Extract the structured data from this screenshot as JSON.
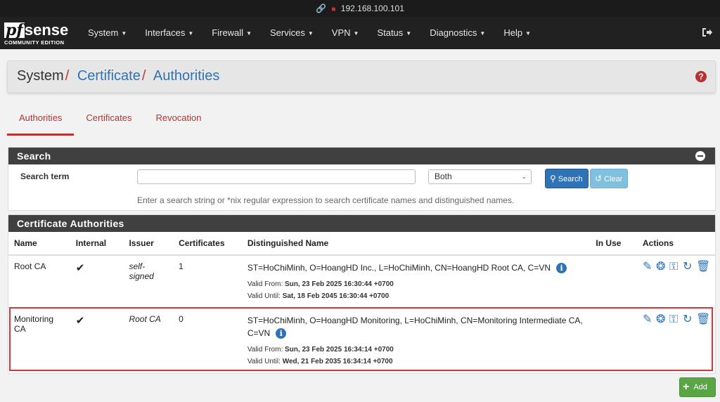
{
  "address_bar": {
    "url": "192.168.100.101"
  },
  "brand": {
    "name_pf": "pf",
    "name_sense": "sense",
    "edition": "COMMUNITY EDITION"
  },
  "nav": [
    {
      "label": "System"
    },
    {
      "label": "Interfaces"
    },
    {
      "label": "Firewall"
    },
    {
      "label": "Services"
    },
    {
      "label": "VPN"
    },
    {
      "label": "Status"
    },
    {
      "label": "Diagnostics"
    },
    {
      "label": "Help"
    }
  ],
  "breadcrumb": {
    "root": "System",
    "level1": "Certificate",
    "level2": "Authorities",
    "sep": "/"
  },
  "tabs": [
    {
      "label": "Authorities"
    },
    {
      "label": "Certificates"
    },
    {
      "label": "Revocation"
    }
  ],
  "search": {
    "title": "Search",
    "term_label": "Search term",
    "term_value": "",
    "scope_value": "Both",
    "search_button": "Search",
    "clear_button": "Clear",
    "hint": "Enter a search string or *nix regular expression to search certificate names and distinguished names."
  },
  "ca_table": {
    "title": "Certificate Authorities",
    "columns": [
      "Name",
      "Internal",
      "Issuer",
      "Certificates",
      "Distinguished Name",
      "In Use",
      "Actions"
    ],
    "rows": [
      {
        "name": "Root CA",
        "internal": "✔",
        "issuer": "self-signed",
        "certificates": "1",
        "dn": "ST=HoChiMinh, O=HoangHD Inc., L=HoChiMinh, CN=HoangHD Root CA, C=VN",
        "valid_from_label": "Valid From:",
        "valid_from": "Sun, 23 Feb 2025 16:30:44 +0700",
        "valid_until_label": "Valid Until:",
        "valid_until": "Sat, 18 Feb 2045 16:30:44 +0700",
        "in_use": ""
      },
      {
        "name": "Monitoring CA",
        "internal": "✔",
        "issuer": "Root CA",
        "certificates": "0",
        "dn": "ST=HoChiMinh, O=HoangHD Monitoring, L=HoChiMinh, CN=Monitoring Intermediate CA, C=VN",
        "valid_from_label": "Valid From:",
        "valid_from": "Sun, 23 Feb 2025 16:34:14 +0700",
        "valid_until_label": "Valid Until:",
        "valid_until": "Wed, 21 Feb 2035 16:34:14 +0700",
        "in_use": ""
      }
    ]
  },
  "add_button": "Add",
  "colors": {
    "navbar": "#212121",
    "accent_red": "#b83232",
    "link_blue": "#2f73b7",
    "add_green": "#5aa646",
    "highlight": "#d8363e"
  }
}
